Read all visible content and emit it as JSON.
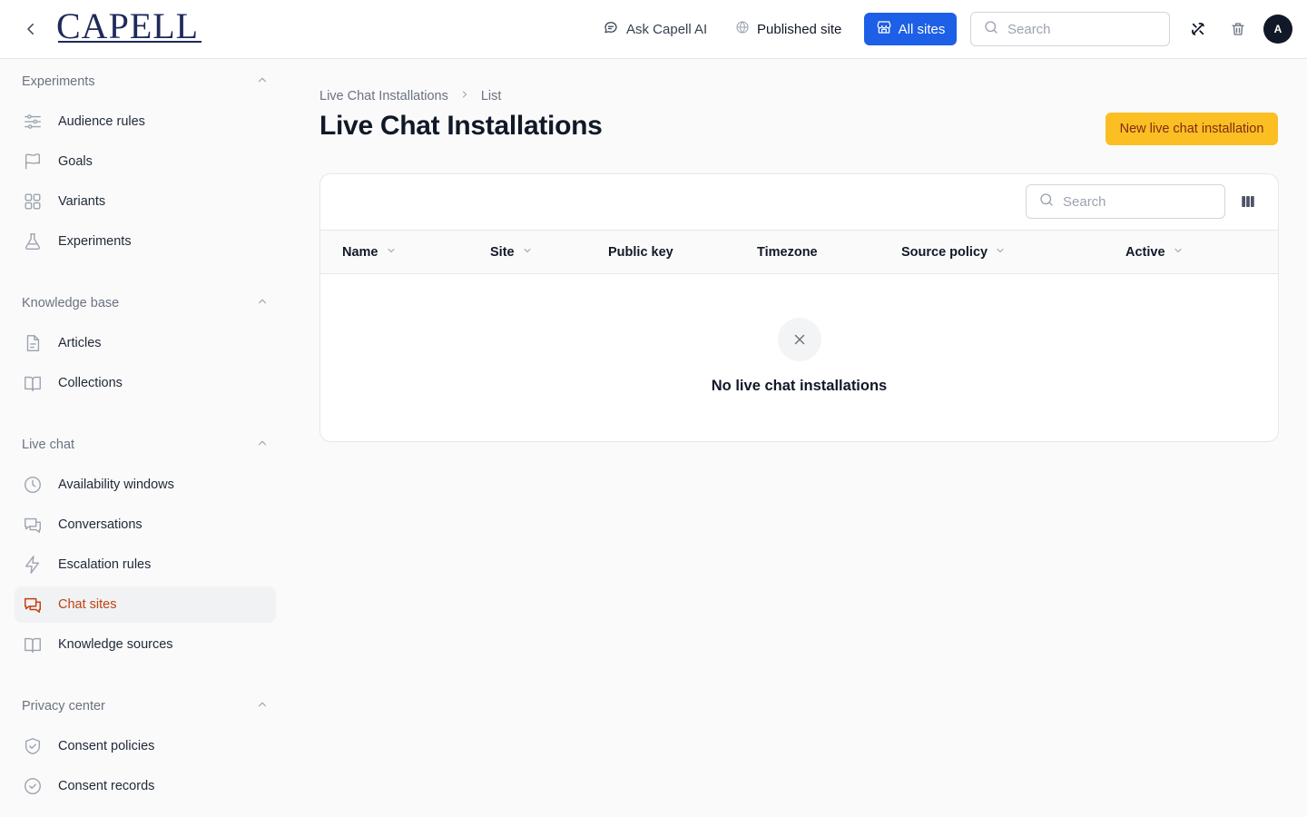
{
  "header": {
    "logo_text": "CAPELL",
    "ask_ai_label": "Ask Capell AI",
    "published_site_label": "Published site",
    "all_sites_label": "All sites",
    "search_placeholder": "Search",
    "avatar_initial": "A"
  },
  "sidebar": {
    "groups": [
      {
        "title": "Experiments",
        "items": [
          {
            "label": "Audience rules",
            "icon": "sliders-icon"
          },
          {
            "label": "Goals",
            "icon": "flag-icon"
          },
          {
            "label": "Variants",
            "icon": "grid-icon"
          },
          {
            "label": "Experiments",
            "icon": "flask-icon"
          }
        ]
      },
      {
        "title": "Knowledge base",
        "items": [
          {
            "label": "Articles",
            "icon": "document-icon"
          },
          {
            "label": "Collections",
            "icon": "book-open-icon"
          }
        ]
      },
      {
        "title": "Live chat",
        "items": [
          {
            "label": "Availability windows",
            "icon": "clock-icon"
          },
          {
            "label": "Conversations",
            "icon": "chat-bubbles-icon"
          },
          {
            "label": "Escalation rules",
            "icon": "bolt-icon"
          },
          {
            "label": "Chat sites",
            "icon": "chat-bubbles-icon",
            "active": true
          },
          {
            "label": "Knowledge sources",
            "icon": "book-open-icon"
          }
        ]
      },
      {
        "title": "Privacy center",
        "items": [
          {
            "label": "Consent policies",
            "icon": "shield-check-icon"
          },
          {
            "label": "Consent records",
            "icon": "check-circle-icon"
          }
        ]
      }
    ]
  },
  "main": {
    "breadcrumb": [
      "Live Chat Installations",
      "List"
    ],
    "title": "Live Chat Installations",
    "new_button_label": "New live chat installation",
    "table": {
      "search_placeholder": "Search",
      "columns": [
        {
          "label": "Name",
          "sortable": true
        },
        {
          "label": "Site",
          "sortable": true
        },
        {
          "label": "Public key",
          "sortable": false
        },
        {
          "label": "Timezone",
          "sortable": false
        },
        {
          "label": "Source policy",
          "sortable": true
        },
        {
          "label": "Active",
          "sortable": true
        }
      ],
      "rows": [],
      "empty_message": "No live chat installations"
    }
  },
  "colors": {
    "primary_blue": "#1d5fe6",
    "accent_amber": "#fbbf24",
    "active_orange": "#c2410c",
    "logo_navy": "#1e2a5a"
  }
}
